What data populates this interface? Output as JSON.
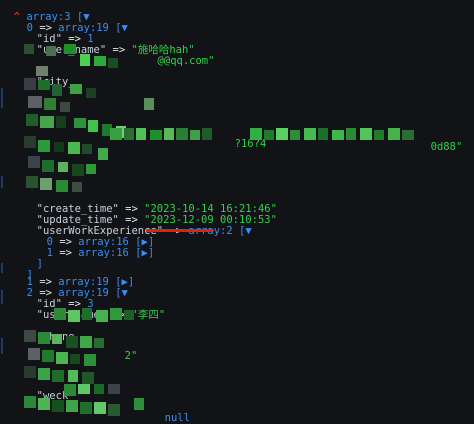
{
  "dump": {
    "root": {
      "caret": "^",
      "label": "array:3",
      "toggle": "[▼"
    },
    "item0": {
      "index": "0",
      "arrow": "=>",
      "label": "array:19",
      "toggle": "[▼"
    },
    "id0": {
      "key": "\"id\"",
      "arrow": "=>",
      "value": "1"
    },
    "user_name0": {
      "key": "\"user_name\"",
      "arrow": "=>",
      "value": "\"施哈哈hah\""
    },
    "email0_fragment": {
      "value": "\"        @@qq.com\""
    },
    "city_fragment": {
      "key": "\"city_"
    },
    "long_fragment_a": {
      "value": "?16?4"
    },
    "long_fragment_b": {
      "value": "0d88\""
    },
    "create_time": {
      "key": "\"create_time\"",
      "arrow": "=>",
      "value": "\"2023-10-14 16:21:46\""
    },
    "update_time": {
      "key": "\"update_time\"",
      "arrow": "=>",
      "value": "\"2023-12-09 00:10:53\""
    },
    "userWorkExperience": {
      "key": "\"userWorkExperience\"",
      "arrow": "=>",
      "label": "array:2",
      "toggle": "[▼"
    },
    "exp0": {
      "index": "0",
      "arrow": "=>",
      "label": "array:16",
      "toggle": "[▶]"
    },
    "exp1": {
      "index": "1",
      "arrow": "=>",
      "label": "array:16",
      "toggle": "[▶]"
    },
    "close_exp": {
      "text": "]"
    },
    "close_item0": {
      "text": "]"
    },
    "item1": {
      "index": "1",
      "arrow": "=>",
      "label": "array:19",
      "toggle": "[▶]"
    },
    "item2": {
      "index": "2",
      "arrow": "=>",
      "label": "array:19",
      "toggle": "[▼"
    },
    "id2": {
      "key": "\"id\"",
      "arrow": "=>",
      "value": "3"
    },
    "user_name2": {
      "key": "\"user_name\"",
      "arrow": "=>",
      "value": "\"李四\""
    },
    "fragment_phone": {
      "key": "\"phone"
    },
    "fragment_2": {
      "value": "2\""
    },
    "fragment_weck": {
      "key": "\"weck"
    },
    "fragment_null": {
      "value": "null"
    }
  },
  "colors": {
    "background": "#111317",
    "structure": "#3b8df2",
    "text": "#e6e6e6",
    "string": "#35d04a",
    "annotation": "#e5200f"
  }
}
